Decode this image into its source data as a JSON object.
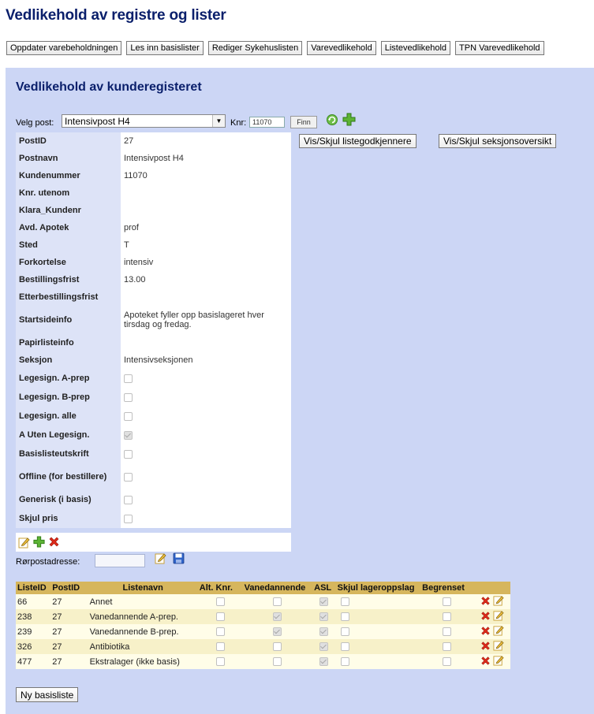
{
  "page_title": "Vedlikehold av registre og lister",
  "nav_buttons": [
    "Oppdater varebeholdningen",
    "Les inn basislister",
    "Rediger Sykehuslisten",
    "Varevedlikehold",
    "Listevedlikehold",
    "TPN Varevedlikehold"
  ],
  "section_title": "Vedlikehold av kunderegisteret",
  "selector": {
    "label": "Velg post:",
    "selected": "Intensivpost H4",
    "knr_label": "Knr:",
    "knr_value": "11070",
    "find_label": "Finn"
  },
  "toggle_buttons": {
    "approvers": "Vis/Skjul listegodkjennere",
    "sections": "Vis/Skjul seksjonsoversikt"
  },
  "fields": [
    {
      "label": "PostID",
      "value": "27"
    },
    {
      "label": "Postnavn",
      "value": "Intensivpost H4"
    },
    {
      "label": "Kundenummer",
      "value": "11070"
    },
    {
      "label": "Knr. utenom",
      "value": ""
    },
    {
      "label": "Klara_Kundenr",
      "value": ""
    },
    {
      "label": "Avd. Apotek",
      "value": "prof"
    },
    {
      "label": "Sted",
      "value": "T"
    },
    {
      "label": "Forkortelse",
      "value": "intensiv"
    },
    {
      "label": "Bestillingsfrist",
      "value": "13.00"
    },
    {
      "label": "Etterbestillingsfrist",
      "value": ""
    },
    {
      "label": "Startsideinfo",
      "value": "Apoteket fyller opp basislageret hver tirsdag og fredag."
    },
    {
      "label": "Papirlisteinfo",
      "value": ""
    },
    {
      "label": "Seksjon",
      "value": "Intensivseksjonen"
    }
  ],
  "checkbox_fields": [
    {
      "label": "Legesign. A-prep",
      "checked": false
    },
    {
      "label": "Legesign. B-prep",
      "checked": false
    },
    {
      "label": "Legesign. alle",
      "checked": false
    },
    {
      "label": "A Uten Legesign.",
      "checked": true
    },
    {
      "label": "Basislisteutskrift",
      "checked": false
    },
    {
      "label": "Offline (for bestillere)",
      "checked": false
    },
    {
      "label": "Generisk (i basis)",
      "checked": false
    },
    {
      "label": "Skjul pris",
      "checked": false
    }
  ],
  "ror": {
    "label": "Rørpostadresse:",
    "value": ""
  },
  "lists": {
    "headers": [
      "ListeID",
      "PostID",
      "Listenavn",
      "Alt. Knr.",
      "Vanedannende",
      "ASL",
      "Skjul lageroppslag",
      "Begrenset"
    ],
    "rows": [
      {
        "id": "66",
        "post": "27",
        "name": "Annet",
        "alt": false,
        "vane": false,
        "asl": true,
        "skjul": false,
        "begr": false
      },
      {
        "id": "238",
        "post": "27",
        "name": "Vanedannende A-prep.",
        "alt": false,
        "vane": true,
        "asl": true,
        "skjul": false,
        "begr": false
      },
      {
        "id": "239",
        "post": "27",
        "name": "Vanedannende B-prep.",
        "alt": false,
        "vane": true,
        "asl": true,
        "skjul": false,
        "begr": false
      },
      {
        "id": "326",
        "post": "27",
        "name": "Antibiotika",
        "alt": false,
        "vane": false,
        "asl": true,
        "skjul": false,
        "begr": false
      },
      {
        "id": "477",
        "post": "27",
        "name": "Ekstralager (ikke basis)",
        "alt": false,
        "vane": false,
        "asl": true,
        "skjul": false,
        "begr": false
      }
    ]
  },
  "new_list_button": "Ny basisliste",
  "icons": {
    "refresh": "refresh-icon",
    "add": "add-icon",
    "edit": "edit-icon",
    "delete": "delete-icon",
    "save": "save-icon"
  }
}
